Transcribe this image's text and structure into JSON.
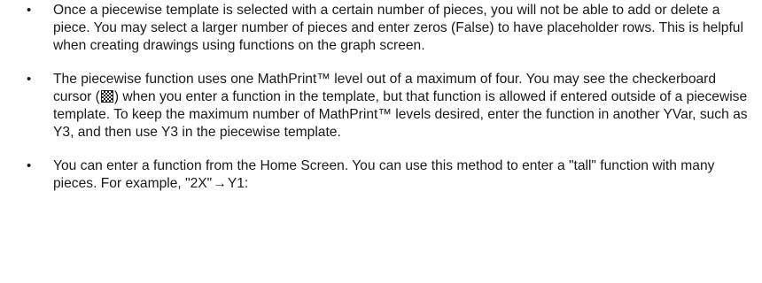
{
  "bullet_symbol": "•",
  "items": [
    {
      "text": "Once a piecewise template is selected with a certain number of pieces, you will not be able to add or delete a piece. You may select a larger number of pieces and enter zeros (False) to have placeholder rows. This is helpful when creating drawings using functions on the graph screen."
    },
    {
      "before_icon": "The piecewise function uses one MathPrint™ level out of a maximum of four. You may see the checkerboard cursor (",
      "icon": "checkerboard-cursor-icon",
      "after_icon": ") when you enter a function in the template, but that function is allowed if entered outside of a piecewise template. To keep the maximum number of MathPrint™ levels desired, enter the function in another YVar, such as Y3, and then use Y3 in the piecewise template."
    },
    {
      "before_arrow": "You can enter a function from the Home Screen. You can use this method to enter a \"tall\" function with many pieces. For example, \"2X\"",
      "arrow": "→",
      "after_arrow": "Y1:"
    }
  ]
}
